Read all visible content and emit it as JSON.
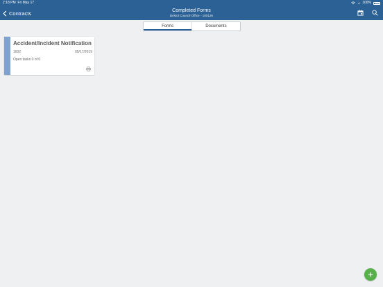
{
  "status_bar": {
    "time": "2:18 PM",
    "date": "Fri May 17",
    "battery": "100%"
  },
  "header": {
    "back_label": "Contracts",
    "title": "Completed Forms",
    "subtitle": "Bristol Council Office - 100126"
  },
  "tabs": [
    {
      "label": "Forms",
      "active": true
    },
    {
      "label": "Documents",
      "active": false
    }
  ],
  "cards": [
    {
      "title": "Accident/Incident Notification",
      "id": "1602",
      "date": "05/17/2019",
      "tasks": "Open tasks 0 of 0"
    }
  ],
  "colors": {
    "header": "#2b6194",
    "card_stripe": "#7fa3d0",
    "fab": "#58b04a",
    "background": "#eef0f2"
  },
  "icons": [
    "back-chevron-icon",
    "calendar-icon",
    "search-icon",
    "print-icon",
    "plus-icon",
    "wifi-icon"
  ]
}
